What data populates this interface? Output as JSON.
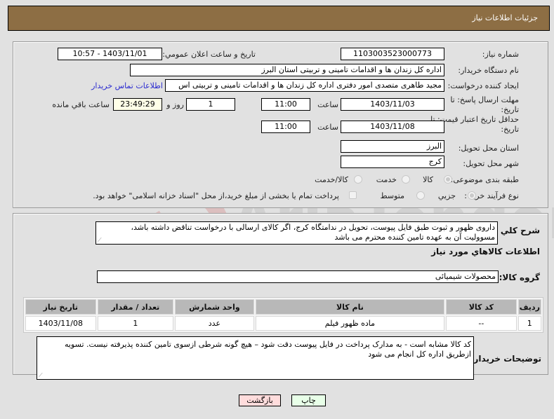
{
  "header": {
    "title": "جزئیات اطلاعات نیاز"
  },
  "form": {
    "need_number": {
      "label": "شماره نیاز:",
      "value": "1103003523000773"
    },
    "announce_datetime": {
      "label": "تاریخ و ساعت اعلان عمومي:",
      "value": "1403/11/01 - 10:57"
    },
    "buyer_org": {
      "label": "نام دستگاه خریدار:",
      "value": "اداره کل زندان ها و اقدامات تامینی و تربیتی استان البرز"
    },
    "requester": {
      "label": "ایجاد کننده درخواست:",
      "value": "مجید طاهری متصدی امور دفتری اداره کل زندان ها و اقدامات تامینی و تربیتی اس"
    },
    "buyer_contact_link": "اطلاعات تماس خریدار",
    "reply_deadline": {
      "label": "مهلت ارسال پاسخ: تا تاریخ:",
      "date": "1403/11/03",
      "time_label": "ساعت",
      "time": "11:00",
      "days": "1",
      "days_label": "روز و",
      "remaining": "23:49:29",
      "remaining_label": "ساعت باقي مانده"
    },
    "price_validity": {
      "label": "حداقل تاریخ اعتبار قیمت: تا تاریخ:",
      "date": "1403/11/08",
      "time_label": "ساعت",
      "time": "11:00"
    },
    "delivery_province": {
      "label": "استان محل تحویل:",
      "value": "البرز"
    },
    "delivery_city": {
      "label": "شهر محل تحویل:",
      "value": "کرج"
    },
    "category": {
      "label": "طبقه بندی موضوعی:",
      "options": [
        "کالا",
        "خدمت",
        "کالا/خدمت"
      ],
      "selected": "کالا"
    },
    "purchase_type": {
      "label": "نوع فرآیند خرید :",
      "options": [
        "جزیي",
        "متوسط"
      ],
      "selected": "جزیي",
      "payment_note": "پرداخت تمام یا بخشی از مبلغ خرید،از محل \"اسناد خزانه اسلامی\" خواهد بود."
    }
  },
  "details": {
    "general_desc_label": "شرح کلي نیاز:",
    "general_desc": "داروی ظهور و ثبوت طبق فایل پیوست، تحویل در ندامتگاه کرج، اگر کالای ارسالی با درخواست تناقض داشته باشد، مسوولیت آن به عهده تامین کننده محترم می باشد",
    "items_section_title": "اطلاعات کالاهاي مورد نیاز",
    "goods_group_label": "گروه کالا:",
    "goods_group": "محصولات شیمیائی",
    "table": {
      "headers": [
        "ردیف",
        "کد کالا",
        "نام کالا",
        "واحد شمارش",
        "تعداد / مقدار",
        "تاریخ نیاز"
      ],
      "rows": [
        [
          "1",
          "--",
          "ماده ظهور فیلم",
          "عدد",
          "1",
          "1403/11/08"
        ]
      ]
    },
    "buyer_notes_label": "توضیحات خریدار:",
    "buyer_notes": "کد کالا مشابه است - به مدارک پرداخت در فایل پیوست دقت شود – هیچ گونه شرطی ازسوی تامین کننده پذیرفته نیست. تسویه ازطریق اداره کل انجام می شود"
  },
  "buttons": {
    "print": "چاپ",
    "back": "بازگشت"
  },
  "colors": {
    "header_bg": "#8d6e44",
    "back_bg": "#ffdcdc",
    "print_bg": "#e8ffe8",
    "link": "#2a2ad0"
  }
}
